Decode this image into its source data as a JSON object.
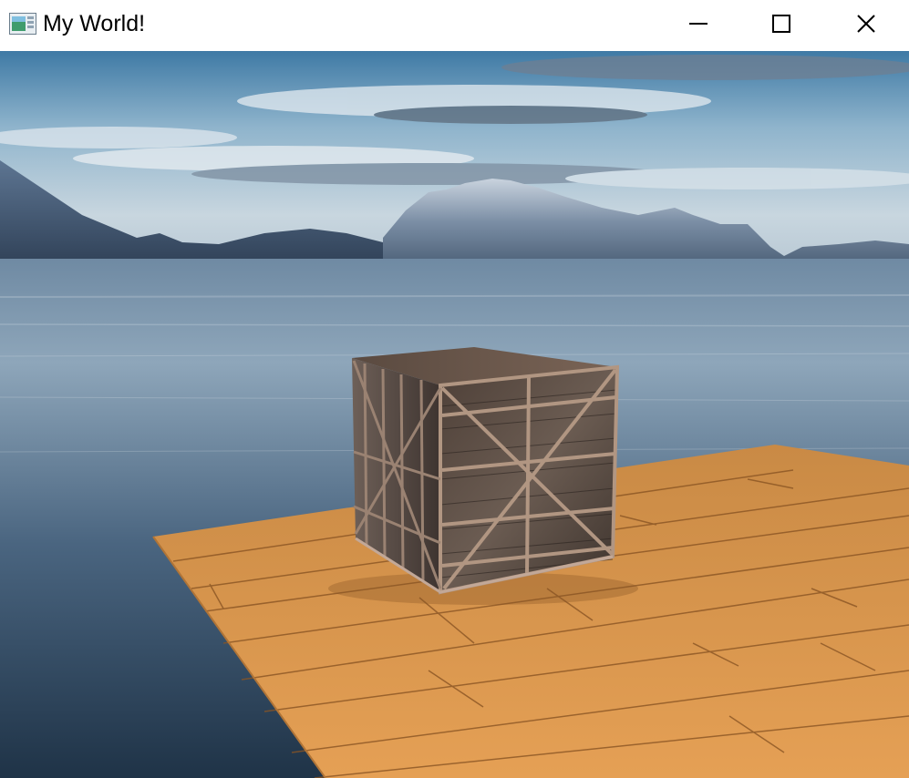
{
  "window": {
    "title": "My World!",
    "app_icon": "app-window-icon",
    "controls": {
      "minimize_icon": "minimize-icon",
      "maximize_icon": "maximize-icon",
      "close_icon": "close-icon"
    }
  },
  "scene": {
    "sky_top_color": "#4a7fa6",
    "sky_horizon_color": "#c9d8e3",
    "water_color": "#3d5a76",
    "wood_floor_color": "#d98e3e",
    "crate_color": "#5d4f46"
  }
}
